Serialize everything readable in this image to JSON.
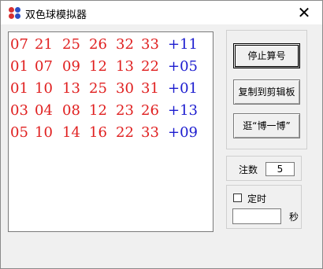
{
  "window": {
    "title": "双色球模拟器",
    "close_glyph": "✕"
  },
  "icon_colors": [
    "#d83030",
    "#2b4fc4",
    "#d83030",
    "#2b4fc4"
  ],
  "colors": {
    "red": "#e02020",
    "blue": "#1c1ccf"
  },
  "results": [
    {
      "red": [
        "07",
        "21",
        "25",
        "26",
        "32",
        "33"
      ],
      "blue": "+11"
    },
    {
      "red": [
        "01",
        "07",
        "09",
        "12",
        "13",
        "22"
      ],
      "blue": "+05"
    },
    {
      "red": [
        "01",
        "10",
        "13",
        "25",
        "30",
        "31"
      ],
      "blue": "+01"
    },
    {
      "red": [
        "03",
        "04",
        "08",
        "12",
        "23",
        "26"
      ],
      "blue": "+13"
    },
    {
      "red": [
        "05",
        "10",
        "14",
        "16",
        "22",
        "33"
      ],
      "blue": "+09"
    }
  ],
  "buttons": {
    "stop": "停止算号",
    "copy": "复制到剪辑板",
    "gamble": "逛“博一博”"
  },
  "count": {
    "label": "注数",
    "value": "5"
  },
  "timer": {
    "label": "定时",
    "checked": false,
    "value": "",
    "unit": "秒"
  }
}
